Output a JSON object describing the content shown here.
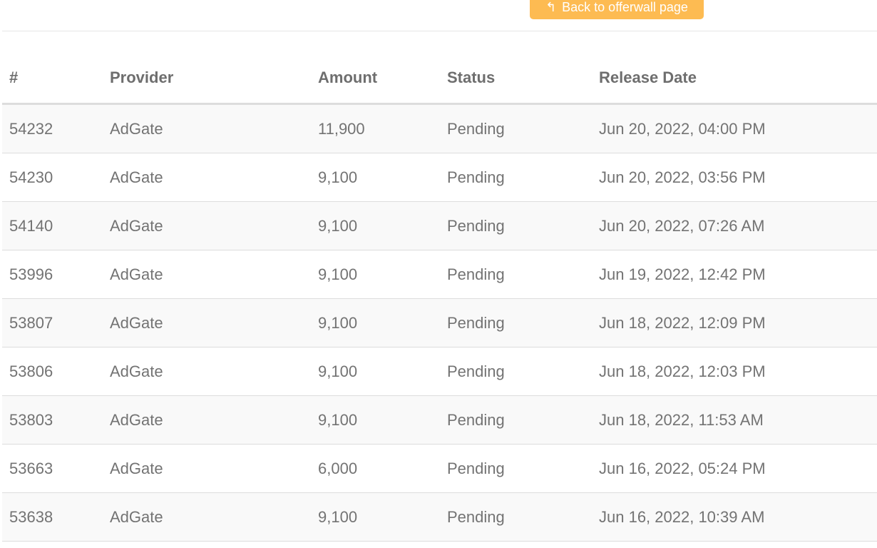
{
  "toolbar": {
    "back_label": "Back to offerwall page",
    "back_icon": "reply-arrow-icon",
    "accent": "#fdbb52"
  },
  "table": {
    "headers": [
      "#",
      "Provider",
      "Amount",
      "Status",
      "Release Date"
    ],
    "rows": [
      [
        "54232",
        "AdGate",
        "11,900",
        "Pending",
        "Jun 20, 2022, 04:00 PM"
      ],
      [
        "54230",
        "AdGate",
        "9,100",
        "Pending",
        "Jun 20, 2022, 03:56 PM"
      ],
      [
        "54140",
        "AdGate",
        "9,100",
        "Pending",
        "Jun 20, 2022, 07:26 AM"
      ],
      [
        "53996",
        "AdGate",
        "9,100",
        "Pending",
        "Jun 19, 2022, 12:42 PM"
      ],
      [
        "53807",
        "AdGate",
        "9,100",
        "Pending",
        "Jun 18, 2022, 12:09 PM"
      ],
      [
        "53806",
        "AdGate",
        "9,100",
        "Pending",
        "Jun 18, 2022, 12:03 PM"
      ],
      [
        "53803",
        "AdGate",
        "9,100",
        "Pending",
        "Jun 18, 2022, 11:53 AM"
      ],
      [
        "53663",
        "AdGate",
        "6,000",
        "Pending",
        "Jun 16, 2022, 05:24 PM"
      ],
      [
        "53638",
        "AdGate",
        "9,100",
        "Pending",
        "Jun 16, 2022, 10:39 AM"
      ]
    ]
  }
}
